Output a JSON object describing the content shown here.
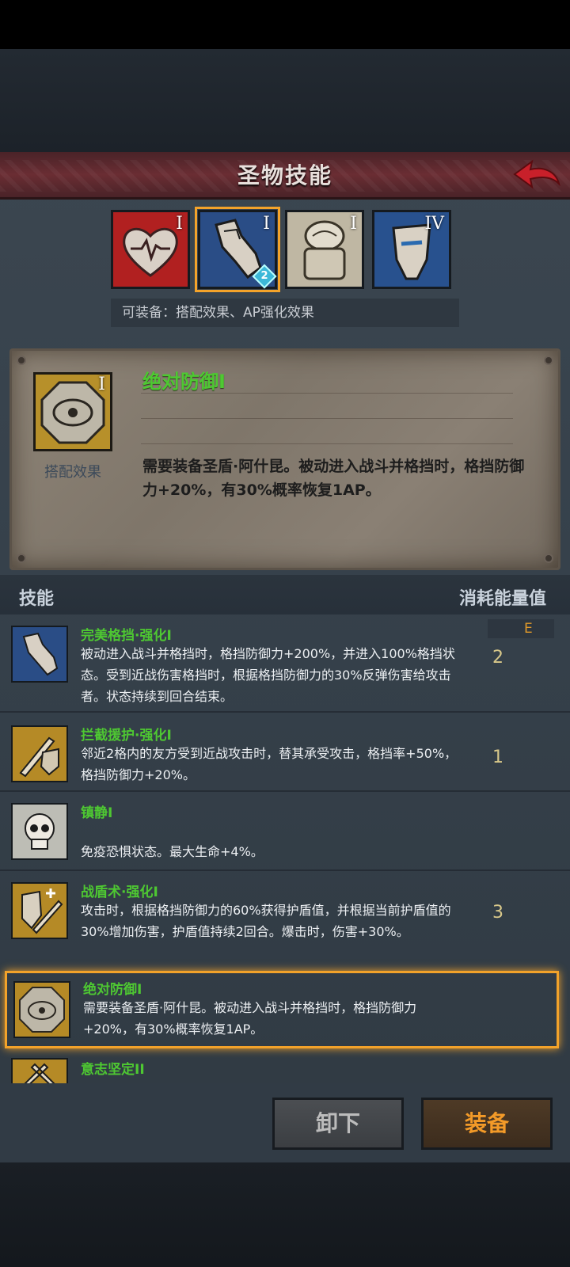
{
  "header": {
    "title": "圣物技能",
    "back_icon": "back-arrow-icon"
  },
  "relic_tabs": [
    {
      "rank": "I",
      "icon": "heartbeat-icon",
      "color": "#b12020"
    },
    {
      "rank": "I",
      "icon": "shield-gauntlet-icon",
      "color": "#2a4d86",
      "badge": "2",
      "selected": true
    },
    {
      "rank": "I",
      "icon": "armored-knight-icon",
      "color": "#bfb7a3"
    },
    {
      "rank": "IV",
      "icon": "helmet-icon",
      "color": "#28518e"
    }
  ],
  "equip_hint": "可装备：搭配效果、AP强化效果",
  "detail": {
    "rank": "I",
    "title": "绝对防御I",
    "type_label": "搭配效果",
    "description": "需要装备圣盾·阿什昆。被动进入战斗并格挡时，格挡防御力+20%，有30%概率恢复1AP。",
    "icon": "octagon-shield-icon"
  },
  "list_header": {
    "left": "技能",
    "right": "消耗能量值",
    "tag": "E"
  },
  "skills": [
    {
      "name": "完美格挡·强化I",
      "desc": "被动进入战斗并格挡时，格挡防御力+200%，并进入100%格挡状态。受到近战伤害格挡时，根据格挡防御力的30%反弹伤害给攻击者。状态持续到回合结束。",
      "cost": "2",
      "icon": "gauntlet-icon",
      "color": "#2a4d86"
    },
    {
      "name": "拦截援护·强化I",
      "desc": "邻近2格内的友方受到近战攻击时，替其承受攻击，格挡率+50%，格挡防御力+20%。",
      "cost": "1",
      "icon": "sword-shield-icon",
      "color": "#b58a26"
    },
    {
      "name": "镇静I",
      "desc": "免疫恐惧状态。最大生命+4%。",
      "cost": "",
      "icon": "skull-icon",
      "color": "#bdbdb5"
    },
    {
      "name": "战盾术·强化I",
      "desc": "攻击时，根据格挡防御力的60%获得护盾值，并根据当前护盾值的30%增加伤害，护盾值持续2回合。爆击时，伤害+30%。",
      "cost": "3",
      "icon": "shield-plus-icon",
      "color": "#b58a26"
    },
    {
      "name": "绝对防御I",
      "desc": "需要装备圣盾·阿什昆。被动进入战斗并格挡时，格挡防御力+20%，有30%概率恢复1AP。",
      "cost": "",
      "icon": "octagon-shield-icon",
      "color": "#b58a26",
      "active": true
    },
    {
      "name": "意志坚定II",
      "desc": "",
      "cost": "",
      "icon": "crossed-swords-icon",
      "color": "#b58a26"
    }
  ],
  "buttons": {
    "unequip": "卸下",
    "equip": "装备"
  }
}
